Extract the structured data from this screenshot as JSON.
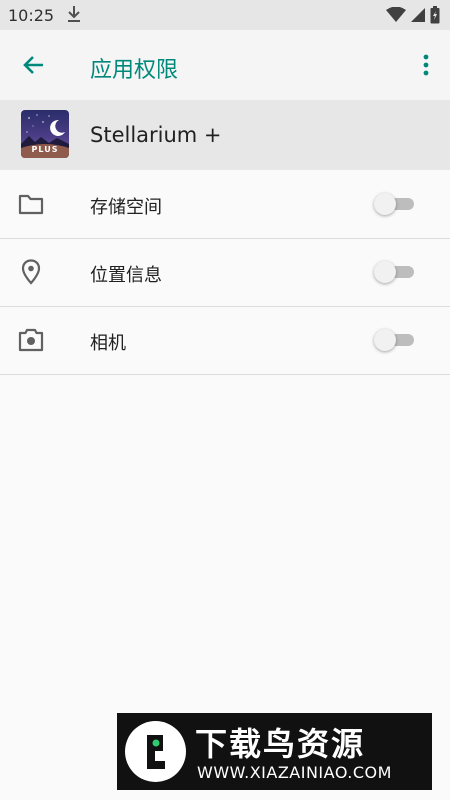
{
  "status_bar": {
    "time": "10:25",
    "icons": [
      "download-icon",
      "wifi-icon",
      "signal-icon",
      "battery-icon"
    ]
  },
  "app_bar": {
    "title": "应用权限",
    "back_icon": "arrow-left-icon",
    "more_icon": "more-vert-icon",
    "accent_color": "#00897b"
  },
  "app": {
    "name": "Stellarium +",
    "icon_badge": "PLUS"
  },
  "permissions": [
    {
      "label": "存储空间",
      "icon": "folder-icon",
      "enabled": false
    },
    {
      "label": "位置信息",
      "icon": "location-pin-icon",
      "enabled": false
    },
    {
      "label": "相机",
      "icon": "camera-icon",
      "enabled": false
    }
  ],
  "watermark": {
    "title": "下载鸟资源",
    "url": "WWW.XIAZAINIAO.COM"
  }
}
